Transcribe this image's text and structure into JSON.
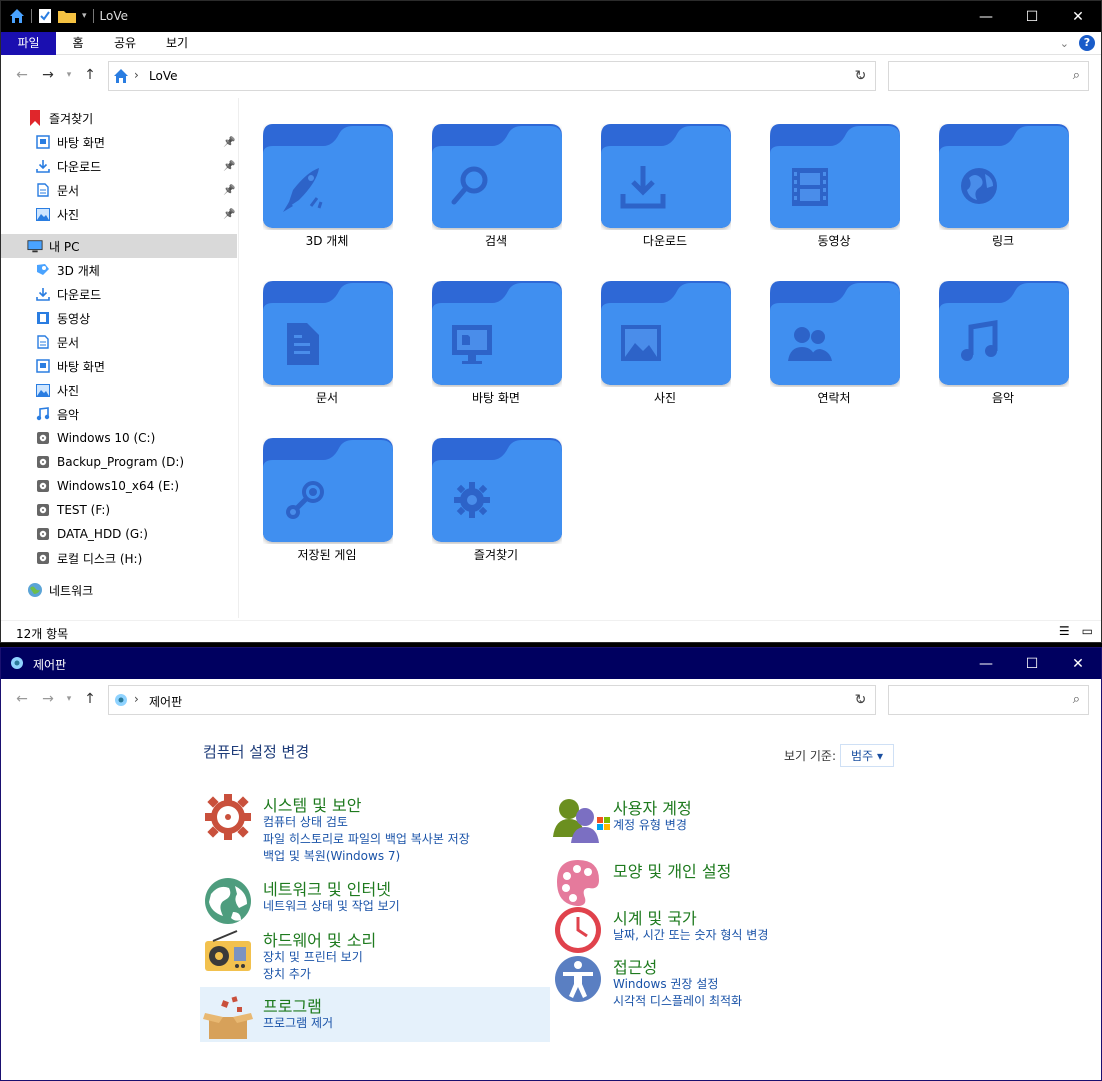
{
  "explorer": {
    "title": "LoVe",
    "tabs": [
      "파일",
      "홈",
      "공유",
      "보기"
    ],
    "address": "LoVe",
    "sidebar": [
      {
        "label": "즐겨찾기",
        "icon": "bookmark-icon",
        "indent": 0
      },
      {
        "label": "바탕 화면",
        "icon": "desktop-icon",
        "indent": 1,
        "pinned": true
      },
      {
        "label": "다운로드",
        "icon": "download-icon",
        "indent": 1,
        "pinned": true
      },
      {
        "label": "문서",
        "icon": "document-icon",
        "indent": 1,
        "pinned": true
      },
      {
        "label": "사진",
        "icon": "picture-icon",
        "indent": 1,
        "pinned": true
      },
      {
        "label": "내 PC",
        "icon": "pc-icon",
        "indent": 0,
        "selected": true
      },
      {
        "label": "3D 개체",
        "icon": "3d-icon",
        "indent": 1
      },
      {
        "label": "다운로드",
        "icon": "download-icon",
        "indent": 1
      },
      {
        "label": "동영상",
        "icon": "video-icon",
        "indent": 1
      },
      {
        "label": "문서",
        "icon": "document-icon",
        "indent": 1
      },
      {
        "label": "바탕 화면",
        "icon": "desktop-icon",
        "indent": 1
      },
      {
        "label": "사진",
        "icon": "picture-icon",
        "indent": 1
      },
      {
        "label": "음악",
        "icon": "music-icon",
        "indent": 1
      },
      {
        "label": "Windows 10 (C:)",
        "icon": "drive-icon",
        "indent": 1
      },
      {
        "label": "Backup_Program (D:)",
        "icon": "drive-icon",
        "indent": 1
      },
      {
        "label": "Windows10_x64 (E:)",
        "icon": "drive-icon",
        "indent": 1
      },
      {
        "label": "TEST (F:)",
        "icon": "drive-icon",
        "indent": 1
      },
      {
        "label": "DATA_HDD (G:)",
        "icon": "drive-icon",
        "indent": 1
      },
      {
        "label": "로컬 디스크 (H:)",
        "icon": "drive-icon",
        "indent": 1
      },
      {
        "label": "네트워크",
        "icon": "network-icon",
        "indent": 0
      }
    ],
    "folders": [
      {
        "label": "3D 개체",
        "glyph": "rocket"
      },
      {
        "label": "검색",
        "glyph": "search"
      },
      {
        "label": "다운로드",
        "glyph": "download"
      },
      {
        "label": "동영상",
        "glyph": "film"
      },
      {
        "label": "링크",
        "glyph": "globe"
      },
      {
        "label": "문서",
        "glyph": "doc"
      },
      {
        "label": "바탕 화면",
        "glyph": "monitor"
      },
      {
        "label": "사진",
        "glyph": "image"
      },
      {
        "label": "연락처",
        "glyph": "contacts"
      },
      {
        "label": "음악",
        "glyph": "music"
      },
      {
        "label": "저장된 게임",
        "glyph": "steam"
      },
      {
        "label": "즐겨찾기",
        "glyph": "gear"
      }
    ],
    "status": "12개 항목"
  },
  "control_panel": {
    "title": "제어판",
    "address": "제어판",
    "heading": "컴퓨터 설정 변경",
    "view_by_label": "보기 기준:",
    "view_by_value": "범주",
    "left": [
      {
        "title": "시스템 및 보안",
        "icon": "gear-shield-icon",
        "links": [
          "컴퓨터 상태 검토",
          "파일 히스토리로 파일의 백업 복사본 저장",
          "백업 및 복원(Windows 7)"
        ]
      },
      {
        "title": "네트워크 및 인터넷",
        "icon": "globe-icon",
        "links": [
          "네트워크 상태 및 작업 보기"
        ]
      },
      {
        "title": "하드웨어 및 소리",
        "icon": "radio-icon",
        "links": [
          "장치 및 프린터 보기",
          "장치 추가"
        ]
      },
      {
        "title": "프로그램",
        "icon": "box-icon",
        "links": [
          "프로그램 제거"
        ]
      }
    ],
    "right": [
      {
        "title": "사용자 계정",
        "icon": "users-icon",
        "links": [
          "계정 유형 변경"
        ]
      },
      {
        "title": "모양 및 개인 설정",
        "icon": "palette-icon",
        "links": []
      },
      {
        "title": "시계 및 국가",
        "icon": "clock-icon",
        "links": [
          "날짜, 시간 또는 숫자 형식 변경"
        ]
      },
      {
        "title": "접근성",
        "icon": "accessibility-icon",
        "links": [
          "Windows 권장 설정",
          "시각적 디스플레이 최적화"
        ]
      }
    ]
  }
}
